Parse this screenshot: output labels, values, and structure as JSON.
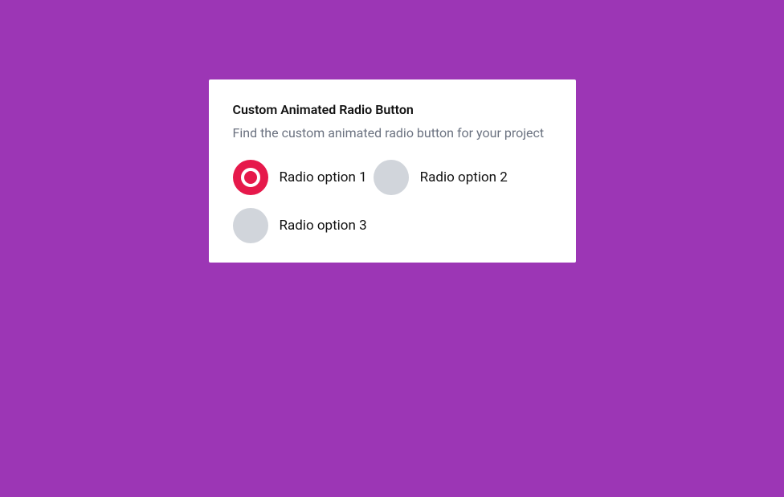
{
  "card": {
    "title": "Custom Animated Radio Button",
    "subtitle": "Find the custom animated radio button for your project"
  },
  "options": [
    {
      "label": "Radio option 1",
      "selected": true
    },
    {
      "label": "Radio option 2",
      "selected": false
    },
    {
      "label": "Radio option 3",
      "selected": false
    }
  ]
}
